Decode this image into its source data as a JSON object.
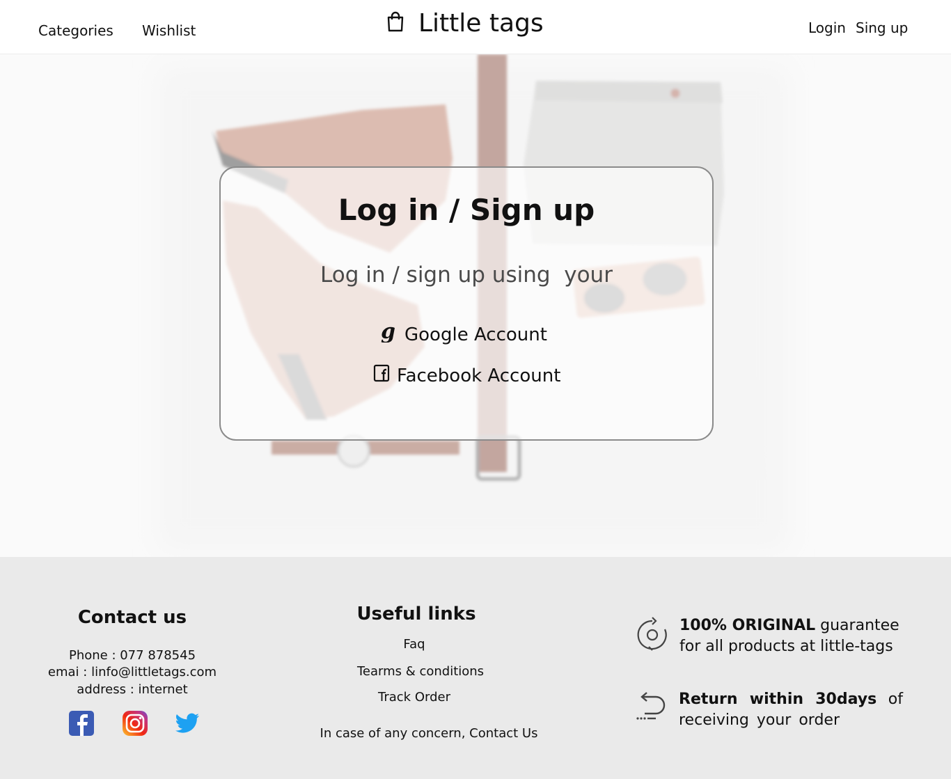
{
  "header": {
    "nav_left": [
      "Categories",
      "Wishlist"
    ],
    "brand_name": "Little tags",
    "login_label": "Login",
    "signup_label": "Sing up"
  },
  "hero": {
    "card_title": "Log in / Sign up",
    "card_subtitle": "Log in / sign up using  your",
    "providers": [
      {
        "label": "Google Account",
        "icon": "google-icon"
      },
      {
        "label": "Facebook Account",
        "icon": "facebook-icon"
      }
    ]
  },
  "footer": {
    "contact": {
      "title": "Contact us",
      "phone": "Phone  : 077 878545",
      "email": "emai : linfo@littletags.com",
      "address": "address : internet",
      "socials": [
        "facebook-icon",
        "instagram-icon",
        "twitter-icon"
      ]
    },
    "links": {
      "title": "Useful links",
      "items": [
        "Faq",
        "Tearms & conditions",
        "Track Order"
      ],
      "concern": "In case of any concern, Contact Us"
    },
    "features": [
      {
        "bold": "100% ORIGINAL",
        "rest": " guarantee for all products at little-tags",
        "icon": "original-badge-icon"
      },
      {
        "bold": "Return within 30days",
        "rest": " of receiving your order",
        "icon": "return-arrow-icon"
      }
    ]
  },
  "colors": {
    "header_bg": "#ffffff",
    "footer_bg": "#eaeaea",
    "card_border": "#8a8a8a",
    "facebook_blue": "#3b5bb4",
    "twitter_blue": "#1da1f2"
  }
}
